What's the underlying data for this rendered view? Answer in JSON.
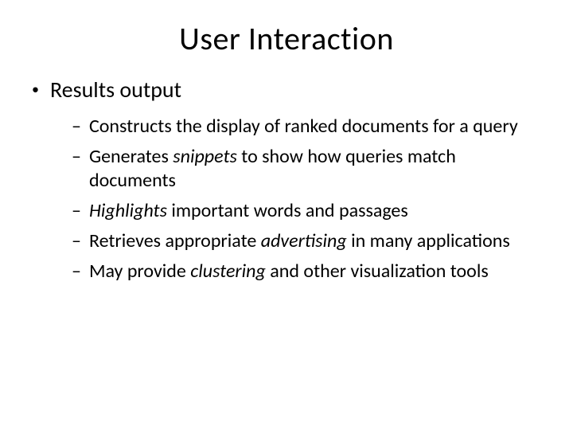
{
  "title": "User Interaction",
  "level1": {
    "marker": "•",
    "label": "Results output"
  },
  "level2": {
    "marker": "–",
    "items": [
      {
        "pre": "Constructs the display of ranked documents for a query"
      },
      {
        "pre": "Generates ",
        "em": "snippets",
        "post": " to show how queries match documents"
      },
      {
        "em": "Highlights",
        "post": " important words and passages"
      },
      {
        "pre": "Retrieves appropriate ",
        "em": "advertising",
        "post": " in many applications"
      },
      {
        "pre": "May provide ",
        "em": "clustering",
        "post": " and other visualization tools"
      }
    ]
  }
}
